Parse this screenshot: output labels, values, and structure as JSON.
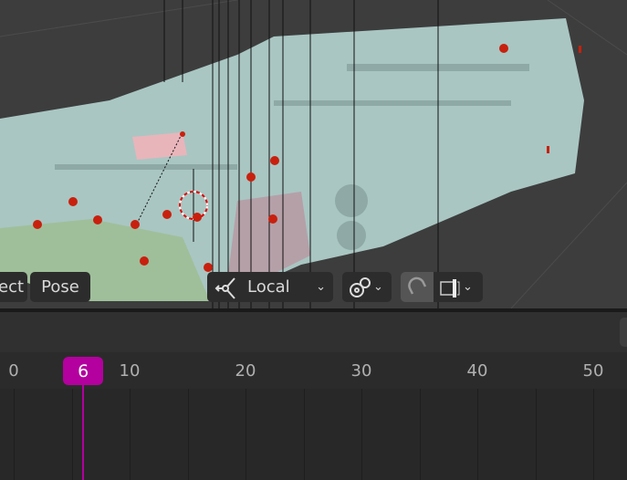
{
  "viewport": {
    "mode_buttons": [
      {
        "label": "ect"
      },
      {
        "label": "Pose"
      }
    ],
    "transform_orientation": {
      "label": "Local",
      "icon": "orientation-icon"
    },
    "pivot_icon": "pivot-point-icon",
    "snap_icon": "snap-magnet-icon",
    "snap_target_icon": "snap-target-icon"
  },
  "timeline": {
    "current_frame": "6",
    "current_frame_value": 6,
    "ticks": [
      {
        "label": "0",
        "frame": 0
      },
      {
        "label": "10",
        "frame": 10
      },
      {
        "label": "20",
        "frame": 20
      },
      {
        "label": "30",
        "frame": 30
      },
      {
        "label": "40",
        "frame": 40
      },
      {
        "label": "50",
        "frame": 50
      }
    ]
  },
  "colors": {
    "playhead": "#b3009e",
    "bone_dots": "#c8200e",
    "model": "#a9c6c2"
  }
}
